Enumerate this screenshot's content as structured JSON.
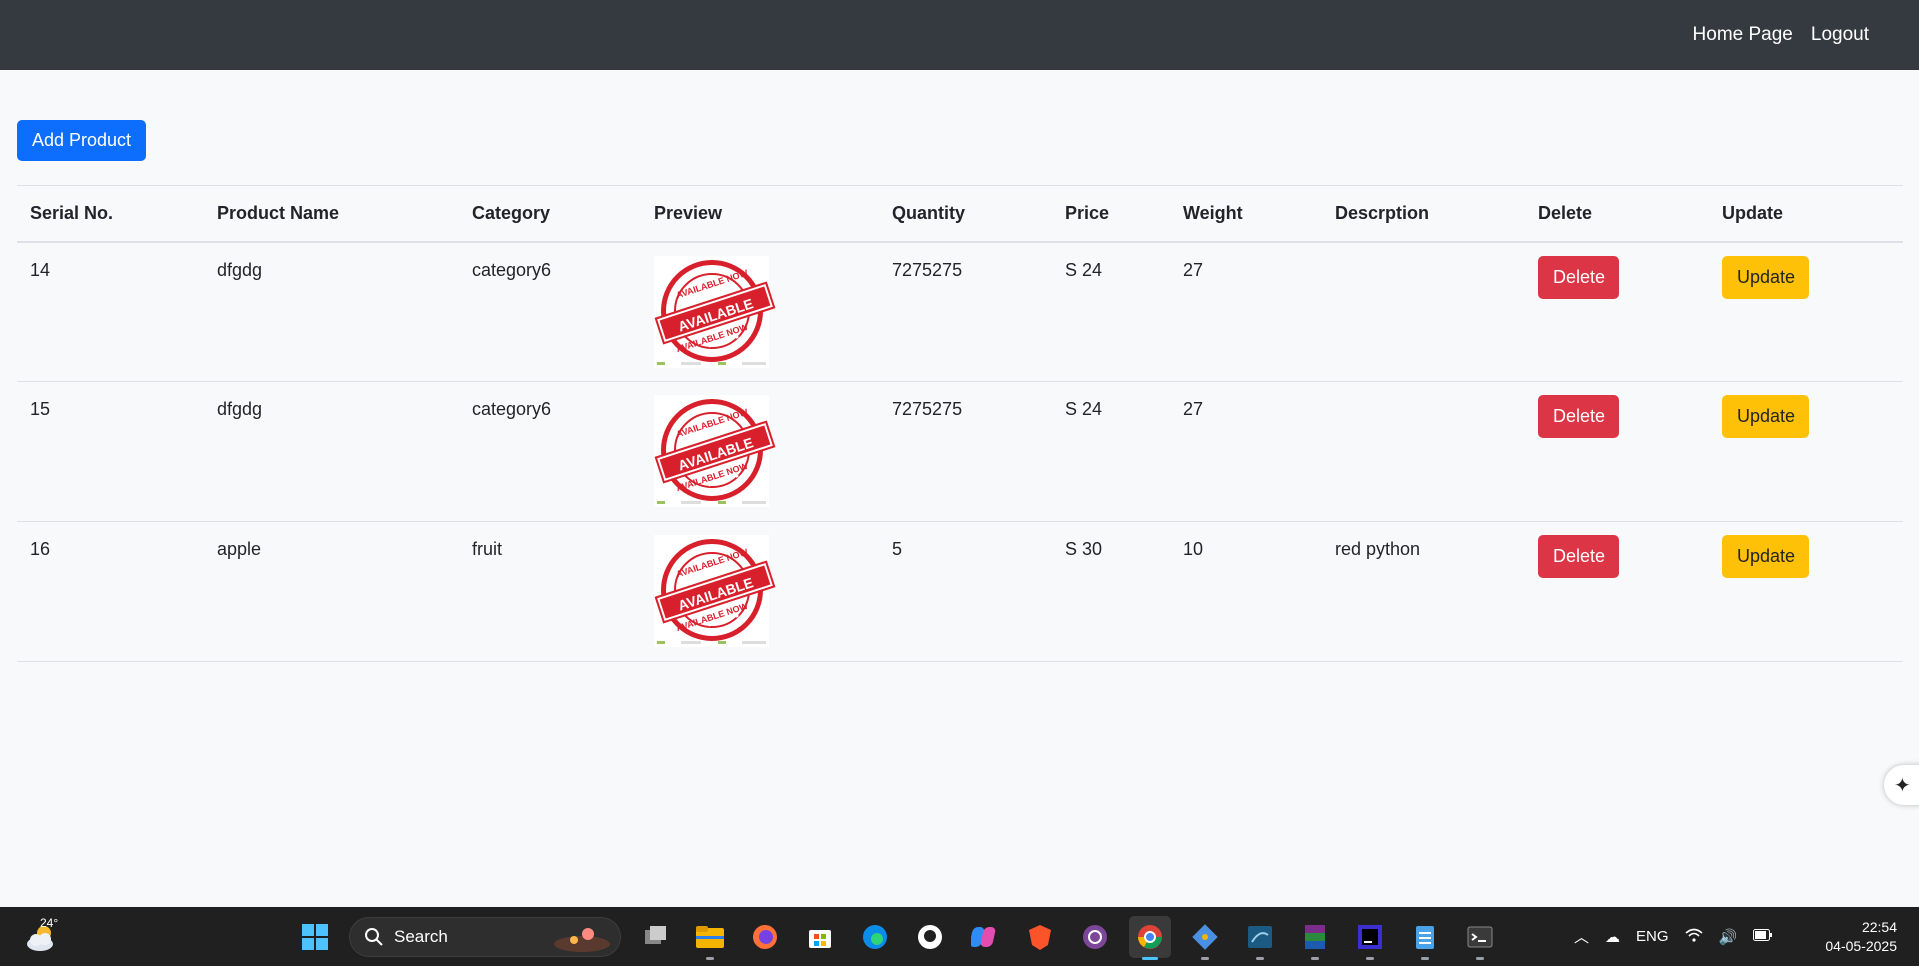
{
  "nav": {
    "home": "Home Page",
    "logout": "Logout"
  },
  "actions": {
    "add_product": "Add Product"
  },
  "table": {
    "headers": [
      "Serial No.",
      "Product Name",
      "Category",
      "Preview",
      "Quantity",
      "Price",
      "Weight",
      "Descrption",
      "Delete",
      "Update"
    ],
    "rows": [
      {
        "serial": "14",
        "name": "dfgdg",
        "category": "category6",
        "quantity": "7275275",
        "price": "S 24",
        "weight": "27",
        "description": "",
        "delete": "Delete",
        "update": "Update"
      },
      {
        "serial": "15",
        "name": "dfgdg",
        "category": "category6",
        "quantity": "7275275",
        "price": "S 24",
        "weight": "27",
        "description": "",
        "delete": "Delete",
        "update": "Update"
      },
      {
        "serial": "16",
        "name": "apple",
        "category": "fruit",
        "quantity": "5",
        "price": "S 30",
        "weight": "10",
        "description": "red python",
        "delete": "Delete",
        "update": "Update"
      }
    ],
    "preview_stamp": {
      "top": "AVAILABLE NOW",
      "banner": "AVAILABLE NOW",
      "bottom": "AVAILABLE NOW"
    }
  },
  "colors": {
    "navbar": "#343a40",
    "primary": "#0d6efd",
    "danger": "#dc3545",
    "warning": "#ffc107",
    "stamp": "#d7202c"
  },
  "taskbar": {
    "weather_temp": "24°",
    "search_label": "Search",
    "apps": [
      "windows-start-icon",
      "task-view-icon",
      "file-explorer-icon",
      "firefox-icon",
      "store-icon",
      "edge-icon",
      "github-icon",
      "copilot-icon",
      "brave-icon",
      "tor-icon",
      "chrome-icon",
      "git-icon",
      "mysql-workbench-icon",
      "winrar-icon",
      "intellij-icon",
      "notepad-icon",
      "terminal-icon"
    ],
    "language": "ENG",
    "time": "22:54",
    "date": "04-05-2025"
  }
}
